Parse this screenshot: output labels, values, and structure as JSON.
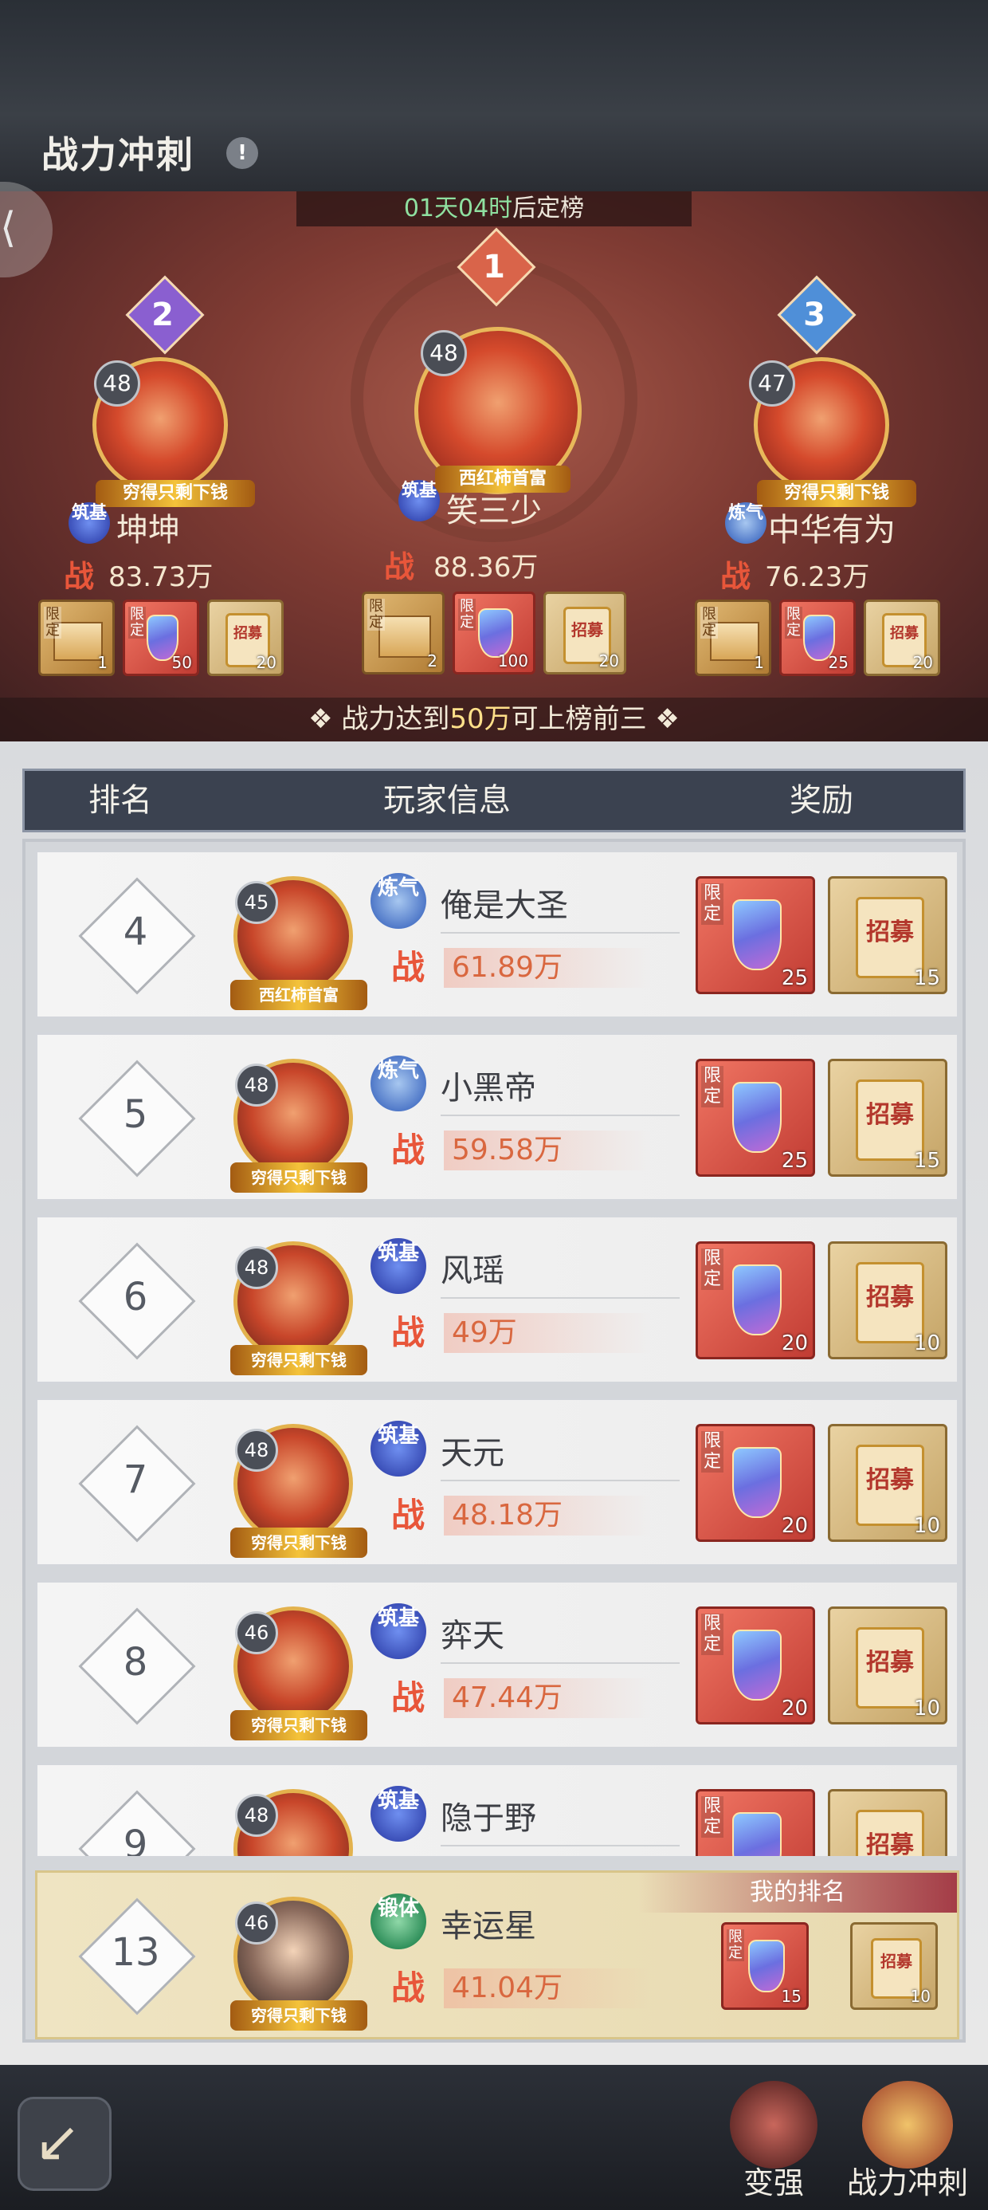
{
  "header": {
    "title": "战力冲刺",
    "info_icon": "!"
  },
  "countdown": {
    "time": "01天04时",
    "suffix": "后定榜"
  },
  "podium": [
    {
      "rank": "2",
      "level": "48",
      "realm": "筑基",
      "name": "坤坤",
      "power": "83.73万",
      "banner": "穷得只剩下钱",
      "rewards": [
        {
          "type": "box",
          "tag": "限定",
          "count": "1"
        },
        {
          "type": "shield",
          "tag": "限定",
          "count": "50"
        },
        {
          "type": "scroll",
          "text": "招募",
          "count": "20"
        }
      ]
    },
    {
      "rank": "1",
      "level": "48",
      "realm": "筑基",
      "name": "笑三少",
      "power": "88.36万",
      "banner": "西红柿首富",
      "rewards": [
        {
          "type": "box",
          "tag": "限定",
          "count": "2"
        },
        {
          "type": "shield",
          "tag": "限定",
          "count": "100"
        },
        {
          "type": "scroll",
          "text": "招募",
          "count": "20"
        }
      ]
    },
    {
      "rank": "3",
      "level": "47",
      "realm": "炼气",
      "name": "中华有为",
      "power": "76.23万",
      "banner": "穷得只剩下钱",
      "rewards": [
        {
          "type": "box",
          "tag": "限定",
          "count": "1"
        },
        {
          "type": "shield",
          "tag": "限定",
          "count": "25"
        },
        {
          "type": "scroll",
          "text": "招募",
          "count": "20"
        }
      ]
    }
  ],
  "zhan_char": "战",
  "threshold": {
    "prefix": "战力达到",
    "value": "50万",
    "suffix": "可上榜前三"
  },
  "table_header": {
    "rank": "排名",
    "player_info": "玩家信息",
    "reward": "奖励"
  },
  "rows": [
    {
      "rank": "4",
      "level": "45",
      "realm": "炼气",
      "name": "俺是大圣",
      "power": "61.89万",
      "banner": "西红柿首富",
      "shield_count": "25",
      "scroll_count": "15"
    },
    {
      "rank": "5",
      "level": "48",
      "realm": "炼气",
      "name": "小黑帝",
      "power": "59.58万",
      "banner": "穷得只剩下钱",
      "shield_count": "25",
      "scroll_count": "15"
    },
    {
      "rank": "6",
      "level": "48",
      "realm": "筑基",
      "name": "风瑶",
      "power": "49万",
      "banner": "穷得只剩下钱",
      "shield_count": "20",
      "scroll_count": "10"
    },
    {
      "rank": "7",
      "level": "48",
      "realm": "筑基",
      "name": "天元",
      "power": "48.18万",
      "banner": "穷得只剩下钱",
      "shield_count": "20",
      "scroll_count": "10"
    },
    {
      "rank": "8",
      "level": "46",
      "realm": "筑基",
      "name": "弈天",
      "power": "47.44万",
      "banner": "穷得只剩下钱",
      "shield_count": "20",
      "scroll_count": "10"
    },
    {
      "rank": "9",
      "level": "48",
      "realm": "筑基",
      "name": "隐于野",
      "power": "",
      "banner": "",
      "shield_count": "",
      "scroll_count": ""
    }
  ],
  "reward_tag": "限定",
  "scroll_text": "招募",
  "my_rank": {
    "label": "我的排名",
    "rank": "13",
    "level": "46",
    "realm": "锻体",
    "name": "幸运星",
    "power": "41.04万",
    "banner": "穷得只剩下钱",
    "shield_count": "15",
    "scroll_count": "10"
  },
  "bottom_nav": {
    "back": "back-arrow",
    "btn1": "变强",
    "btn2": "战力冲刺"
  },
  "colors": {
    "accent_red": "#e8563a",
    "gold": "#e3b24d",
    "header_dark": "#3b4250",
    "countdown_green": "#8fe0a0"
  }
}
